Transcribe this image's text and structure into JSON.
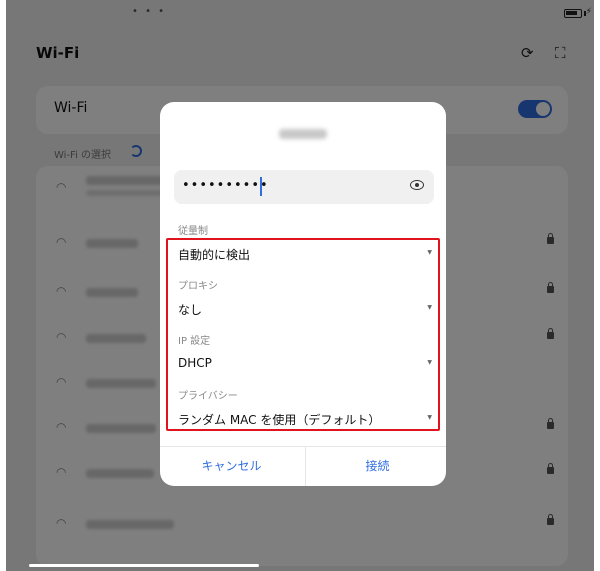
{
  "status_bar": {
    "dots": "• • •"
  },
  "header": {
    "title": "Wi-Fi",
    "refresh_icon": "refresh-icon",
    "scan_icon": "qr-scan-icon"
  },
  "wifi_toggle": {
    "label": "Wi-Fi",
    "on": true
  },
  "network_section": {
    "label": "Wi-Fi の選択"
  },
  "networks": [
    {
      "locked": false
    },
    {
      "locked": true
    },
    {
      "locked": true
    },
    {
      "locked": true
    },
    {
      "locked": false
    },
    {
      "locked": true
    },
    {
      "locked": true
    },
    {
      "locked": true
    }
  ],
  "dialog": {
    "password_value": "••••••••••",
    "metered": {
      "label": "従量制",
      "value": "自動的に検出"
    },
    "proxy": {
      "label": "プロキシ",
      "value": "なし"
    },
    "ip_settings": {
      "label": "IP 設定",
      "value": "DHCP"
    },
    "privacy": {
      "label": "プライバシー",
      "value": "ランダム MAC を使用（デフォルト）"
    },
    "cancel_label": "キャンセル",
    "connect_label": "接続"
  },
  "colors": {
    "accent": "#2f6de0",
    "highlight": "#e0141e"
  }
}
